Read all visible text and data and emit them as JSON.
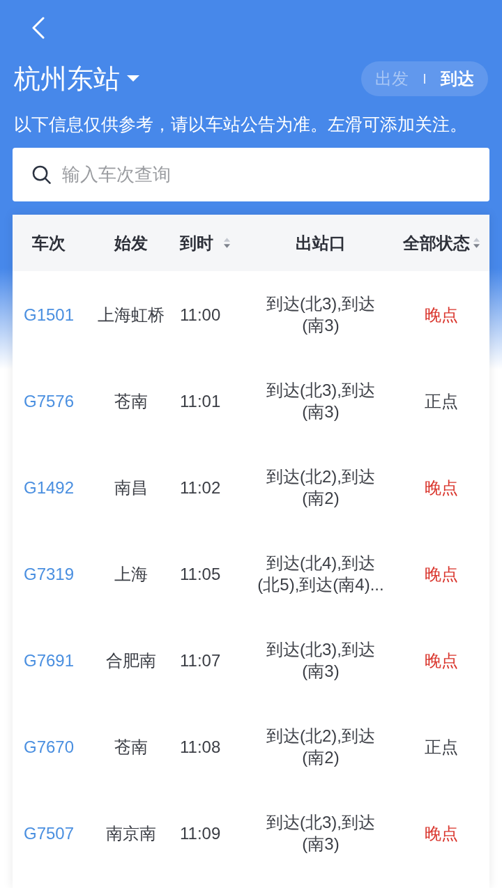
{
  "header": {
    "station": "杭州东站",
    "mode_toggle": [
      {
        "label": "出发",
        "selected": false
      },
      {
        "label": "到达",
        "selected": true
      }
    ],
    "notice": "以下信息仅供参考，请以车站公告为准。左滑可添加关注。"
  },
  "search": {
    "placeholder": "输入车次查询"
  },
  "table": {
    "columns": [
      {
        "label": "车次",
        "sortable": false
      },
      {
        "label": "始发",
        "sortable": false
      },
      {
        "label": "到时",
        "sortable": true
      },
      {
        "label": "出站口",
        "sortable": false
      },
      {
        "label": "全部状态",
        "sortable": true
      }
    ],
    "rows": [
      {
        "train": "G1501",
        "origin": "上海虹桥",
        "arrival": "11:00",
        "exit": "到达(北3),到达(南3)",
        "status": "晚点",
        "late": true
      },
      {
        "train": "G7576",
        "origin": "苍南",
        "arrival": "11:01",
        "exit": "到达(北3),到达(南3)",
        "status": "正点",
        "late": false
      },
      {
        "train": "G1492",
        "origin": "南昌",
        "arrival": "11:02",
        "exit": "到达(北2),到达(南2)",
        "status": "晚点",
        "late": true
      },
      {
        "train": "G7319",
        "origin": "上海",
        "arrival": "11:05",
        "exit": "到达(北4),到达(北5),到达(南4)...",
        "status": "晚点",
        "late": true
      },
      {
        "train": "G7691",
        "origin": "合肥南",
        "arrival": "11:07",
        "exit": "到达(北3),到达(南3)",
        "status": "晚点",
        "late": true
      },
      {
        "train": "G7670",
        "origin": "苍南",
        "arrival": "11:08",
        "exit": "到达(北2),到达(南2)",
        "status": "正点",
        "late": false
      },
      {
        "train": "G7507",
        "origin": "南京南",
        "arrival": "11:09",
        "exit": "到达(北3),到达(南3)",
        "status": "晚点",
        "late": true
      }
    ]
  }
}
